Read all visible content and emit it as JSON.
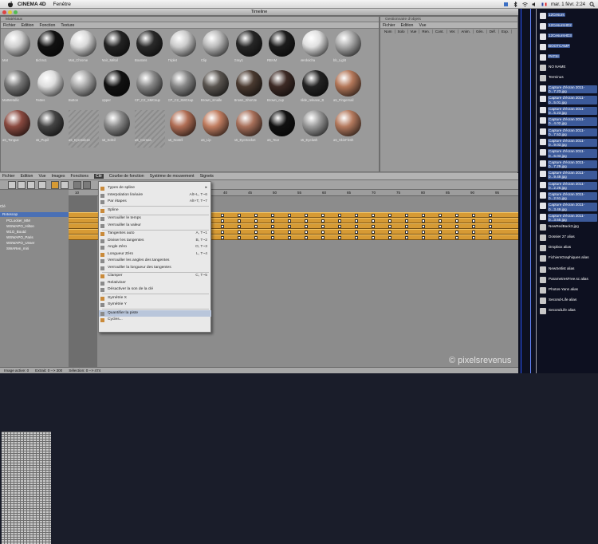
{
  "menubar": {
    "app": "CINEMA 4D",
    "menu1": "Fenêtre",
    "clock": "mar. 1 févr.  2:24"
  },
  "window": {
    "title": "Timeline"
  },
  "material_manager": {
    "header": "Matériaux",
    "menu": [
      "Fichier",
      "Edition",
      "Fonction",
      "Texture"
    ],
    "materials": [
      {
        "name": "Mat",
        "color": "#cfcfcf"
      },
      {
        "name": "Bichro1",
        "color": "#111111"
      },
      {
        "name": "Mat_Chrome",
        "color": "#d9d9d9"
      },
      {
        "name": "Noir_Métal",
        "color": "#232323"
      },
      {
        "name": "Boutons",
        "color": "#2a2a2a"
      },
      {
        "name": "Triplet",
        "color": "#cccccc"
      },
      {
        "name": "Clip",
        "color": "#bbbbbb"
      },
      {
        "name": "Gray1",
        "color": "#262626"
      },
      {
        "name": "RBVM",
        "color": "#1c1c1c"
      },
      {
        "name": "Verdoicha",
        "color": "#e0e0e0"
      },
      {
        "name": "bb_Light",
        "color": "#aaaaaa"
      },
      {
        "name": "MatMetallic",
        "color": "#777777"
      },
      {
        "name": "Pattes",
        "color": "#dddddd"
      },
      {
        "name": "Button",
        "color": "#aaaaaa"
      },
      {
        "name": "Upper",
        "color": "#111111"
      },
      {
        "name": "CP_C2_SMCsup",
        "color": "#888888"
      },
      {
        "name": "CP_C2_SMCsup",
        "color": "#888888"
      },
      {
        "name": "Brown_smalle",
        "color": "#5a5550"
      },
      {
        "name": "Brown_ShortJe",
        "color": "#4a3a30"
      },
      {
        "name": "Brown_cup",
        "color": "#3d2a25"
      },
      {
        "name": "slide_release_B",
        "color": "#222222"
      },
      {
        "name": "a5_Fingernail",
        "color": "#b4785a"
      },
      {
        "name": "a5_Tongue",
        "color": "#8a4a40"
      },
      {
        "name": "a5_Pupil",
        "color": "#444444"
      },
      {
        "name": "a5_EyeSoleze",
        "color": ""
      },
      {
        "name": "a5_Soleil",
        "color": "#8a8a8a"
      },
      {
        "name": "a5_Cornea",
        "color": ""
      },
      {
        "name": "a5_Nostril",
        "color": "#b06e55"
      },
      {
        "name": "a5_Lip",
        "color": "#c07d60"
      },
      {
        "name": "a5_EyeSocket",
        "color": "#a8705a"
      },
      {
        "name": "a5_Tear",
        "color": "#111111"
      },
      {
        "name": "a5_Eyelash",
        "color": "#9a9a9a"
      },
      {
        "name": "a5_SkinFlesh",
        "color": "#b47a5e"
      }
    ]
  },
  "object_manager": {
    "header": "Gestionnaire d'objets",
    "menu": [
      "Fichier",
      "Edition",
      "Vue"
    ],
    "columns": [
      "Nom",
      "Solo",
      "Vue",
      "Ren.",
      "Cont.",
      "Ver.",
      "Anim.",
      "Gén.",
      "Déf.",
      "Exp."
    ]
  },
  "timeline": {
    "menu": [
      "Fichier",
      "Edition",
      "Vue",
      "Images",
      "Fonctions",
      "Clé",
      "Courbe de fonction",
      "Système de mouvement",
      "Signets"
    ],
    "active_menu_index": 5,
    "ruler": [
      "10",
      "15",
      "20",
      "25",
      "30",
      "35",
      "40",
      "45",
      "50",
      "55",
      "60",
      "65",
      "70",
      "75",
      "80",
      "85",
      "90",
      "95"
    ],
    "list_header": "Clé",
    "list_root": "Rotoscop",
    "tracks": [
      "PCLocker_MM",
      "WSWAPO_Hilton",
      "W1O_Boutd",
      "WSWAPO_Paris",
      "WSWAPO_Unser",
      "SWARen_miri"
    ]
  },
  "cle_menu": {
    "items": [
      {
        "label": "Types de spline",
        "shortcut": "▸",
        "sep_after": false,
        "hl": false
      },
      {
        "label": "Interpolation linéaire",
        "shortcut": "Alt+L, T~6",
        "sep_after": false,
        "hl": false
      },
      {
        "label": "Par étapes",
        "shortcut": "Alt+T, T~7",
        "sep_after": true,
        "hl": false
      },
      {
        "label": "Spline",
        "shortcut": "",
        "sep_after": true,
        "hl": false
      },
      {
        "label": "Verrouiller le temps",
        "shortcut": "",
        "sep_after": false,
        "hl": false
      },
      {
        "label": "Verrouiller la valeur",
        "shortcut": "",
        "sep_after": true,
        "hl": false
      },
      {
        "label": "Tangentes auto",
        "shortcut": "A, T~1",
        "sep_after": false,
        "hl": false
      },
      {
        "label": "Diviser les tangentes",
        "shortcut": "B, T~2",
        "sep_after": false,
        "hl": false
      },
      {
        "label": "Angle Zéro",
        "shortcut": "O, T~3",
        "sep_after": false,
        "hl": false
      },
      {
        "label": "Longueur Zéro",
        "shortcut": "L, T~4",
        "sep_after": false,
        "hl": false
      },
      {
        "label": "Verrouiller les angles des tangentes",
        "shortcut": "",
        "sep_after": false,
        "hl": false
      },
      {
        "label": "Verrouiller la longueur des tangentes",
        "shortcut": "",
        "sep_after": true,
        "hl": false
      },
      {
        "label": "Clamper",
        "shortcut": "C, T~5",
        "sep_after": false,
        "hl": false
      },
      {
        "label": "Relativiser",
        "shortcut": "",
        "sep_after": false,
        "hl": false
      },
      {
        "label": "Désactiver la son de la clé",
        "shortcut": "",
        "sep_after": true,
        "hl": false
      },
      {
        "label": "Symétrie X",
        "shortcut": "",
        "sep_after": false,
        "hl": false
      },
      {
        "label": "Symétrie Y",
        "shortcut": "",
        "sep_after": true,
        "hl": false
      },
      {
        "label": "Quantifier la piste",
        "shortcut": "",
        "sep_after": false,
        "hl": true
      },
      {
        "label": "Cycles...",
        "shortcut": "",
        "sep_after": false,
        "hl": false
      }
    ]
  },
  "status": [
    "Image active: 0",
    "Extrait: 0 --> 300",
    "Sélection: 0 --> 474"
  ],
  "desktop": [
    {
      "label": "12Cesurs",
      "plain": false
    },
    {
      "label": "12CesursHD2",
      "plain": false
    },
    {
      "label": "12CesursHD3",
      "plain": false
    },
    {
      "label": "BOOTCAMP",
      "plain": false
    },
    {
      "label": "PATSI",
      "plain": false
    },
    {
      "label": "NO NAME",
      "plain": true
    },
    {
      "label": "Terminus",
      "plain": true
    },
    {
      "label": "Capture d'écran 2011-0...7.23.jpg",
      "plain": false
    },
    {
      "label": "Capture d'écran 2011-0...5.01.jpg",
      "plain": false
    },
    {
      "label": "Capture d'écran 2011-0...5.23.jpg",
      "plain": false
    },
    {
      "label": "Capture d'écran 2011-0...4.02.jpg",
      "plain": false
    },
    {
      "label": "Capture d'écran 2011-0...7.53.jpg",
      "plain": false
    },
    {
      "label": "Capture d'écran 2011-0...9.03.jpg",
      "plain": false
    },
    {
      "label": "Capture d'écran 2011-0...6.03.jpg",
      "plain": false
    },
    {
      "label": "Capture d'écran 2011-0...7.29.jpg",
      "plain": false
    },
    {
      "label": "Capture d'écran 2011-0...9.49.jpg",
      "plain": false
    },
    {
      "label": "Capture d'écran 2011-0...2.26.jpg",
      "plain": false
    },
    {
      "label": "Capture d'écran 2011-0...2.51.jpg",
      "plain": false
    },
    {
      "label": "Capture d'écran 2011-0...3.49.jpg",
      "plain": false
    },
    {
      "label": "Capture d'écran 2011-0...3.55.jpg",
      "plain": false
    },
    {
      "label": "NewRedBack3.jpg",
      "plain": true
    },
    {
      "label": "Dossier 27 alias",
      "plain": true
    },
    {
      "label": "Dropbox alias",
      "plain": true
    },
    {
      "label": "FichiersGraphiques alias",
      "plain": true
    },
    {
      "label": "NewSetlist alias",
      "plain": true
    },
    {
      "label": "ParametresFree.sc alias",
      "plain": true
    },
    {
      "label": "Photos-Yann alias",
      "plain": true
    },
    {
      "label": "Second-Life alias",
      "plain": true
    },
    {
      "label": "SecondLife alias",
      "plain": true
    }
  ],
  "watermark": "© pixelsrevenus"
}
